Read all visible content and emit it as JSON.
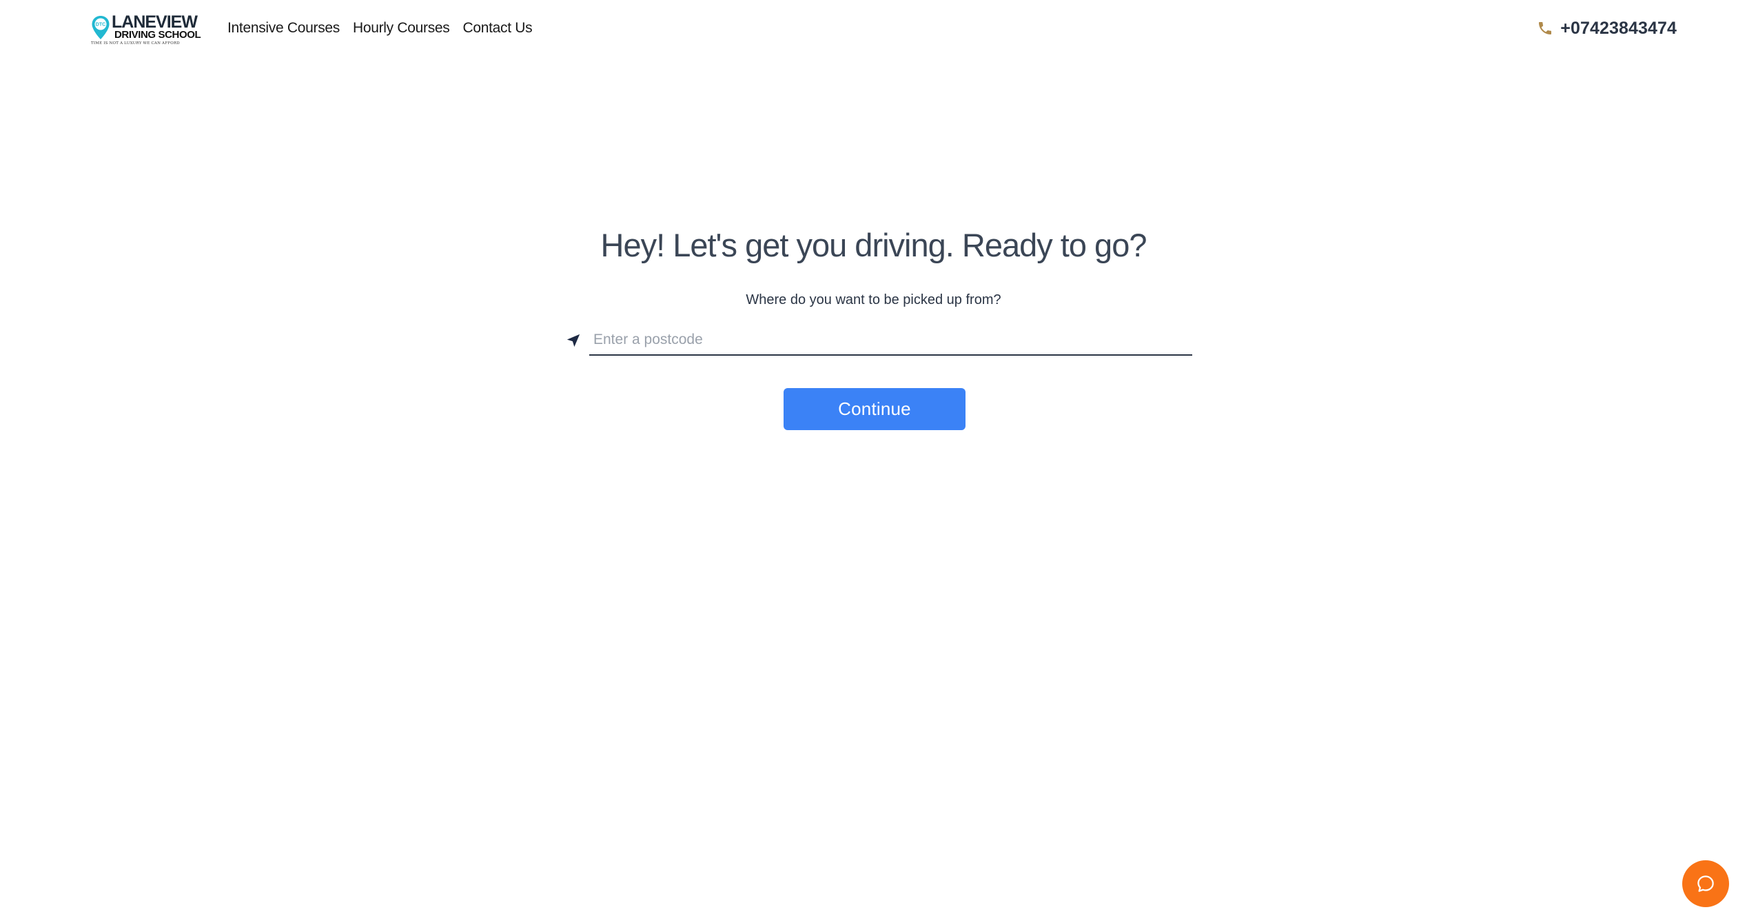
{
  "header": {
    "logo": {
      "line1": "LANEVIEW",
      "line2": "DRIVING SCHOOL",
      "tagline": "TIME IS NOT A LUXURY WE CAN AFFORD",
      "pin_text": "DTC",
      "pin_color": "#22b8d1"
    },
    "nav": [
      {
        "label": "Intensive Courses"
      },
      {
        "label": "Hourly Courses"
      },
      {
        "label": "Contact Us"
      }
    ],
    "phone": {
      "icon": "phone-icon",
      "icon_color": "#b08a4b",
      "number": "+07423843474"
    }
  },
  "main": {
    "title": "Hey! Let's get you driving. Ready to go?",
    "subtitle": "Where do you want to be picked up from?",
    "postcode": {
      "icon": "location-arrow-icon",
      "value": "",
      "placeholder": "Enter a postcode"
    },
    "continue_label": "Continue",
    "accent_color": "#3b82f6"
  },
  "chat": {
    "icon": "chat-bubble-icon",
    "color": "#f97316"
  }
}
